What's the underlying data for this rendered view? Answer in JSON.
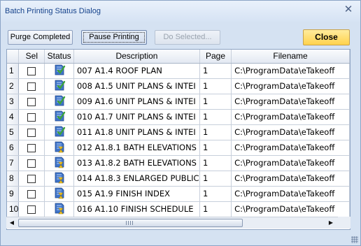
{
  "window": {
    "title": "Batch Printing Status Dialog"
  },
  "toolbar": {
    "purge_label": "Purge Completed",
    "pause_label": "Pause Printing",
    "do_selected_label": "Do Selected...",
    "close_label": "Close"
  },
  "grid": {
    "columns": [
      "Sel",
      "Status",
      "Description",
      "Page",
      "Filename"
    ],
    "rows": [
      {
        "num": "1",
        "status": "completed",
        "description": "007 A1.4 ROOF PLAN",
        "page": "1",
        "filename": "C:\\ProgramData\\eTakeoff"
      },
      {
        "num": "2",
        "status": "completed",
        "description": "008 A1.5 UNIT PLANS & INTEI",
        "page": "1",
        "filename": "C:\\ProgramData\\eTakeoff"
      },
      {
        "num": "3",
        "status": "completed",
        "description": "009 A1.6 UNIT PLANS & INTEI",
        "page": "1",
        "filename": "C:\\ProgramData\\eTakeoff"
      },
      {
        "num": "4",
        "status": "completed",
        "description": "010 A1.7 UNIT PLANS & INTEI",
        "page": "1",
        "filename": "C:\\ProgramData\\eTakeoff"
      },
      {
        "num": "5",
        "status": "completed",
        "description": "011 A1.8 UNIT PLANS & INTEI",
        "page": "1",
        "filename": "C:\\ProgramData\\eTakeoff"
      },
      {
        "num": "6",
        "status": "pending",
        "description": "012 A1.8.1 BATH ELEVATIONS",
        "page": "1",
        "filename": "C:\\ProgramData\\eTakeoff"
      },
      {
        "num": "7",
        "status": "pending",
        "description": "013 A1.8.2 BATH ELEVATIONS",
        "page": "1",
        "filename": "C:\\ProgramData\\eTakeoff"
      },
      {
        "num": "8",
        "status": "pending",
        "description": "014 A1.8.3 ENLARGED PUBLIC",
        "page": "1",
        "filename": "C:\\ProgramData\\eTakeoff"
      },
      {
        "num": "9",
        "status": "pending",
        "description": "015 A1.9 FINISH INDEX",
        "page": "1",
        "filename": "C:\\ProgramData\\eTakeoff"
      },
      {
        "num": "10",
        "status": "pending",
        "description": "016 A1.10 FINISH SCHEDULE",
        "page": "1",
        "filename": "C:\\ProgramData\\eTakeoff"
      }
    ]
  },
  "icons": {
    "close": "close-icon",
    "completed": "document-check-icon",
    "pending": "document-hourglass-icon",
    "scroll_left": "scroll-left-icon",
    "scroll_right": "scroll-right-icon"
  },
  "colors": {
    "dialog_bg": "#d5e2f2",
    "title_text": "#15428b",
    "close_button": "#ffd24c"
  }
}
